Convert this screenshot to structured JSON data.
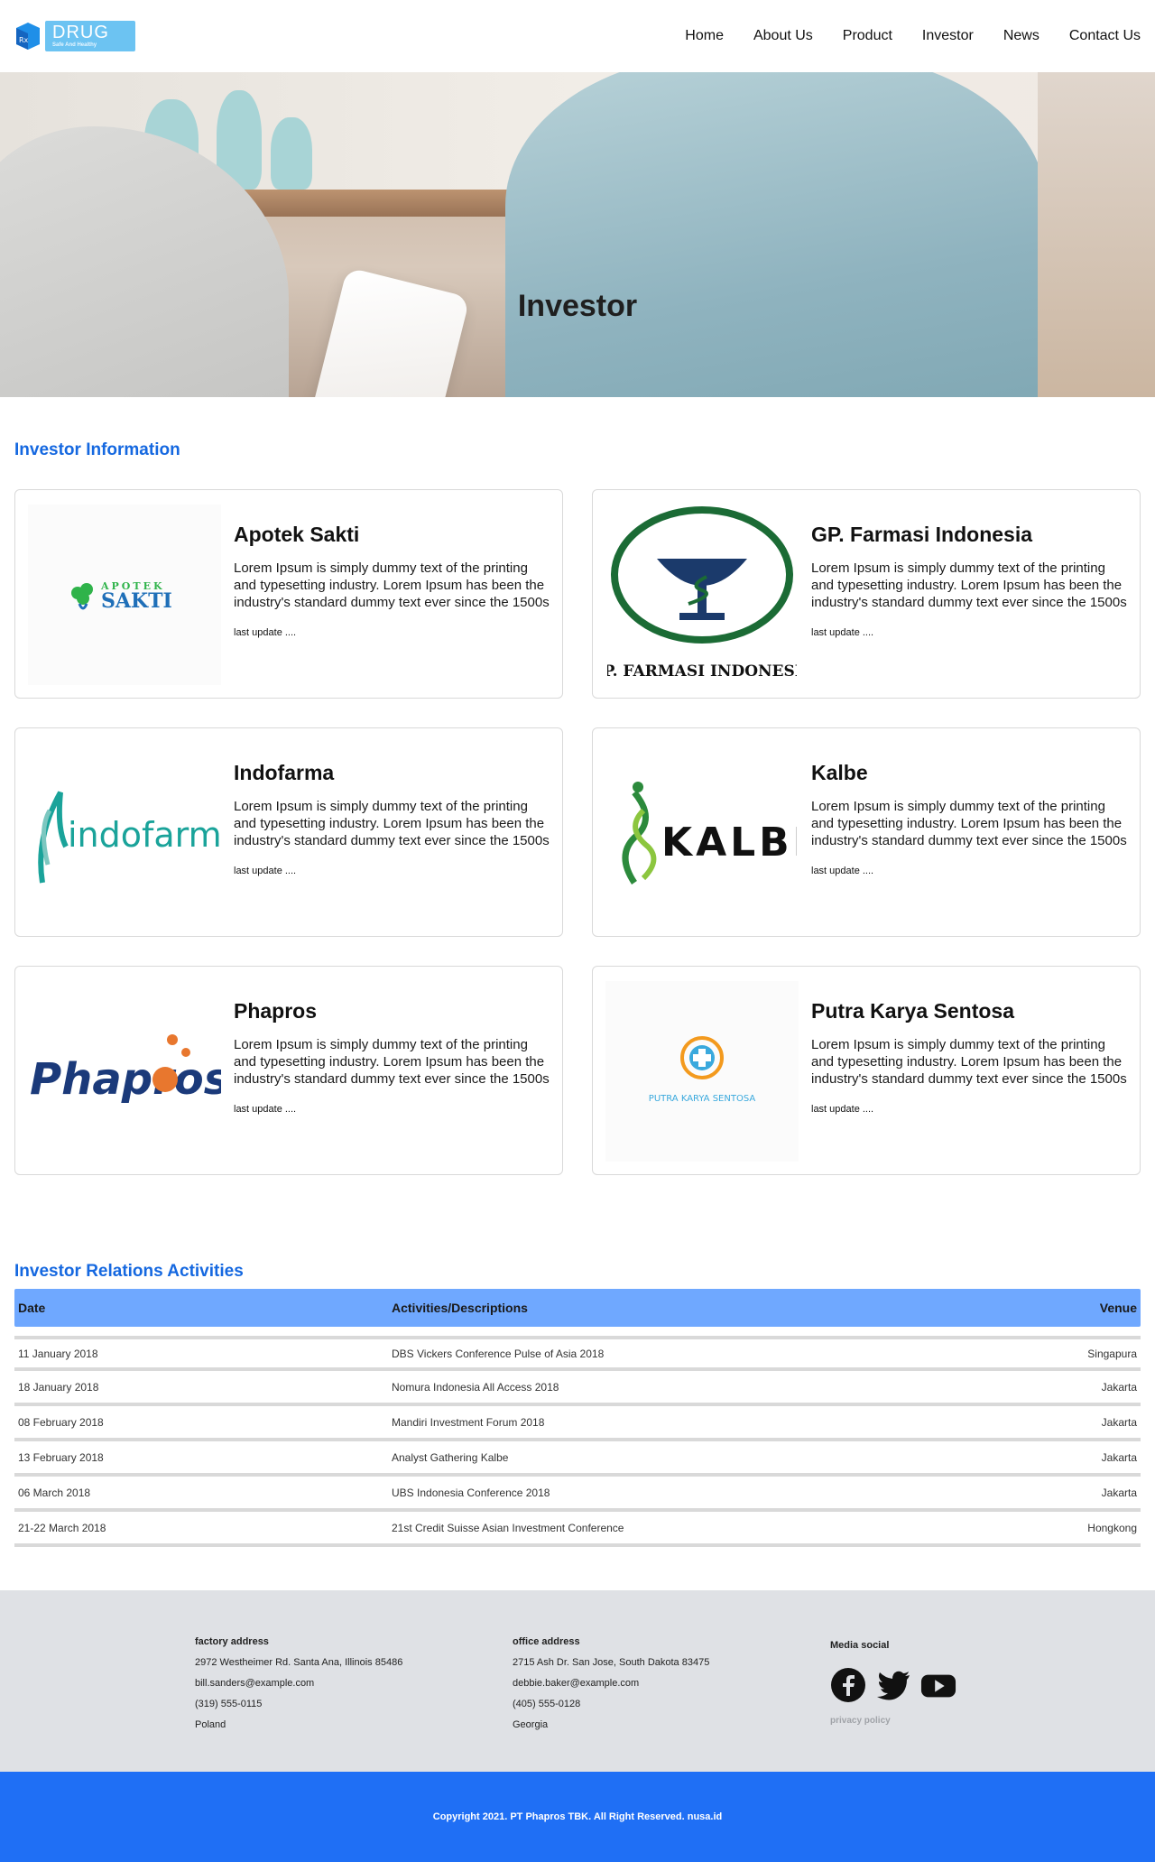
{
  "brand": {
    "name": "DRUG",
    "tagline": "Safe And Healthy"
  },
  "nav": {
    "items": [
      "Home",
      "About Us",
      "Product",
      "Investor",
      "News",
      "Contact Us"
    ]
  },
  "hero": {
    "title": "Investor"
  },
  "investor_info": {
    "title": "Investor Information",
    "cards": [
      {
        "name": "Apotek Sakti",
        "logo_text": "SAKTI",
        "logo_top": "APOTEK",
        "desc": "Lorem Ipsum is simply dummy text of the printing and typesetting industry. Lorem Ipsum has been the industry's standard dummy text ever since the 1500s",
        "update": "last update ...."
      },
      {
        "name": "GP. Farmasi Indonesia",
        "logo_text": "GP. FARMASI INDONESIA",
        "desc": "Lorem Ipsum is simply dummy text of the printing and typesetting industry. Lorem Ipsum has been the industry's standard dummy text ever since the 1500s",
        "update": "last update ...."
      },
      {
        "name": "Indofarma",
        "logo_text": "indofarma",
        "desc": "Lorem Ipsum is simply dummy text of the printing and typesetting industry. Lorem Ipsum has been the industry's standard dummy text ever since the 1500s",
        "update": "last update ...."
      },
      {
        "name": "Kalbe",
        "logo_text": "KALBE",
        "desc": "Lorem Ipsum is simply dummy text of the printing and typesetting industry. Lorem Ipsum has been the industry's standard dummy text ever since the 1500s",
        "update": "last update ...."
      },
      {
        "name": "Phapros",
        "logo_text": "Phapros",
        "desc": "Lorem Ipsum is simply dummy text of the printing and typesetting industry. Lorem Ipsum has been the industry's standard dummy text ever since the 1500s",
        "update": "last update ...."
      },
      {
        "name": "Putra Karya Sentosa",
        "logo_text": "PUTRA KARYA SENTOSA",
        "desc": "Lorem Ipsum is simply dummy text of the printing and typesetting industry. Lorem Ipsum has been the industry's standard dummy text ever since the 1500s",
        "update": "last update ...."
      }
    ]
  },
  "activities": {
    "title": "Investor Relations Activities",
    "headers": {
      "date": "Date",
      "activity": "Activities/Descriptions",
      "venue": "Venue"
    },
    "rows": [
      {
        "date": "11 January 2018",
        "activity": "DBS Vickers Conference Pulse of Asia 2018",
        "venue": "Singapura"
      },
      {
        "date": "18 January 2018",
        "activity": "Nomura Indonesia All Access 2018",
        "venue": "Jakarta"
      },
      {
        "date": "08 February 2018",
        "activity": "Mandiri Investment Forum 2018",
        "venue": "Jakarta"
      },
      {
        "date": "13 February 2018",
        "activity": "Analyst Gathering Kalbe",
        "venue": "Jakarta"
      },
      {
        "date": "06 March 2018",
        "activity": "UBS Indonesia Conference 2018",
        "venue": "Jakarta"
      },
      {
        "date": "21-22 March 2018",
        "activity": "21st Credit Suisse Asian Investment Conference",
        "venue": "Hongkong"
      }
    ]
  },
  "footer": {
    "factory": {
      "head": "factory address",
      "address": "2972 Westheimer Rd. Santa Ana, Illinois 85486",
      "email": "bill.sanders@example.com",
      "phone": "(319) 555-0115",
      "country": "Poland"
    },
    "office": {
      "head": "office address",
      "address": "2715 Ash Dr. San Jose, South Dakota 83475",
      "email": "debbie.baker@example.com",
      "phone": "(405) 555-0128",
      "country": "Georgia"
    },
    "social": {
      "head": "Media social",
      "icons": [
        "facebook-icon",
        "twitter-icon",
        "youtube-icon"
      ],
      "privacy": "privacy policy"
    },
    "copyright": "Copyright 2021. PT Phapros TBK. All Right Reserved. nusa.id"
  },
  "colors": {
    "accent": "#1568e0",
    "table_header": "#6fa8ff",
    "footer_bg": "#dfe1e5",
    "copyright_bg": "#1f6ff5"
  }
}
